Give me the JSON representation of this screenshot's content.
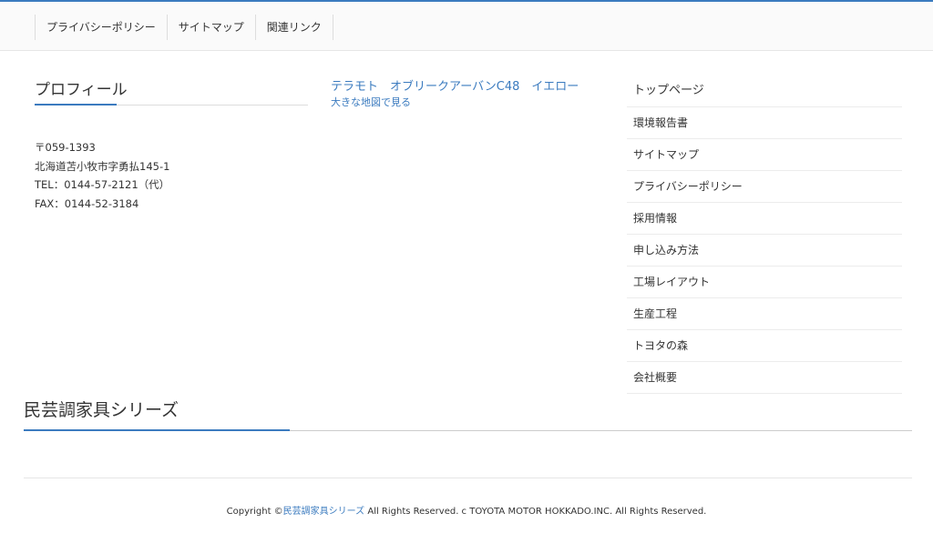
{
  "top_nav": [
    "プライバシーポリシー",
    "サイトマップ",
    "関連リンク"
  ],
  "profile": {
    "title": "プロフィール",
    "address_lines": [
      "〒059-1393",
      "北海道苫小牧市字勇払145-1",
      "TEL：0144-57-2121（代）",
      "FAX：0144-52-3184"
    ]
  },
  "map": {
    "title": "テラモト　オブリークアーバンC48　イエロー",
    "link": "大きな地図で見る"
  },
  "side_menu": [
    "トップページ",
    "環境報告書",
    "サイトマップ",
    "プライバシーポリシー",
    "採用情報",
    "申し込み方法",
    "工場レイアウト",
    "生産工程",
    "トヨタの森",
    "会社概要"
  ],
  "series": {
    "title": "民芸調家具シリーズ"
  },
  "footer": {
    "prefix": "Copyright ©",
    "link": "民芸調家具シリーズ",
    "suffix": " All Rights Reserved. c TOYOTA MOTOR HOKKADO.INC. All Rights Reserved."
  },
  "colors": {
    "accent": "#3b7bbf",
    "text": "#333333"
  }
}
